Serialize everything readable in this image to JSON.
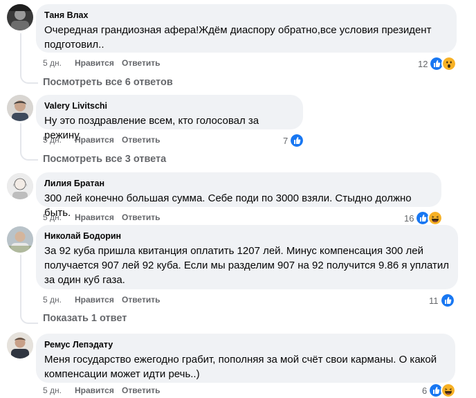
{
  "comments": [
    {
      "author": "Таня Влах",
      "text": "Очередная грандиозная афера!Ждём диаспору обратно,все условия президент\nподготовил..",
      "time": "5 дн.",
      "like": "Нравится",
      "reply": "Ответить",
      "reaction_count": "12",
      "reactions": [
        "like-icon",
        "wow-icon"
      ],
      "replies_link": "Посмотреть все 6 ответов"
    },
    {
      "author": "Valery Livitschi",
      "text": "Ну это поздравление всем, кто голосовал за режину.",
      "time": "5 дн.",
      "like": "Нравится",
      "reply": "Ответить",
      "reaction_count": "7",
      "reactions": [
        "like-icon"
      ],
      "replies_link": "Посмотреть все 3 ответа"
    },
    {
      "author": "Лилия Братан",
      "text": "300 лей конечно большая сумма. Себе поди по 3000 взяли. Стыдно должно быть.",
      "time": "5 дн.",
      "like": "Нравится",
      "reply": "Ответить",
      "reaction_count": "16",
      "reactions": [
        "like-icon",
        "haha-icon"
      ]
    },
    {
      "author": "Николай Бодорин",
      "text": "За 92 куба пришла квитанция оплатить 1207 лей. Минус компенсация 300 лей\nполучается 907 лей 92 куба. Если мы разделим 907 на 92 получится 9.86 я уплатил\nза один куб газа.",
      "time": "5 дн.",
      "like": "Нравится",
      "reply": "Ответить",
      "reaction_count": "11",
      "reactions": [
        "like-icon"
      ],
      "replies_link": "Показать 1 ответ"
    },
    {
      "author": "Ремус Лепэдату",
      "text": "Меня государство ежегодно грабит, пополняя за мой счёт свои карманы. О какой\nкомпенсации может идти речь..)",
      "time": "5 дн.",
      "like": "Нравится",
      "reply": "Ответить",
      "reaction_count": "6",
      "reactions": [
        "like-icon",
        "haha-icon"
      ]
    }
  ],
  "colors": {
    "bubble": "#f0f2f5",
    "like_blue": "#1877f2",
    "emoji_yellow": "#f7b125",
    "secondary_text": "#65676b"
  }
}
